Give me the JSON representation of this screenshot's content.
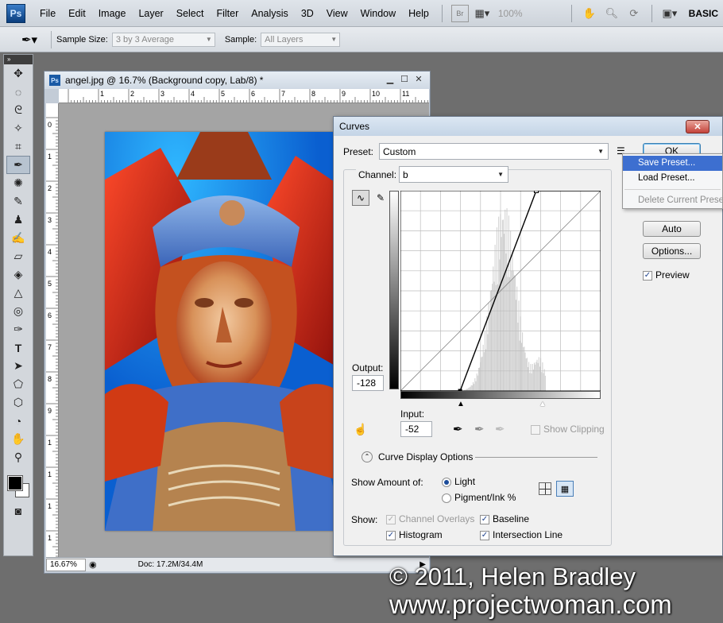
{
  "menubar": {
    "logo": "Ps",
    "items": [
      "File",
      "Edit",
      "Image",
      "Layer",
      "Select",
      "Filter",
      "Analysis",
      "3D",
      "View",
      "Window",
      "Help"
    ],
    "zoom": "100%",
    "br_label": "Br",
    "workspace": "BASIC"
  },
  "options": {
    "sample_size_label": "Sample Size:",
    "sample_size_value": "3 by 3 Average",
    "sample_label": "Sample:",
    "sample_value": "All Layers"
  },
  "document": {
    "title": "angel.jpg @ 16.7% (Background copy, Lab/8) *",
    "zoom": "16.67%",
    "doc_info": "Doc: 17.2M/34.4M",
    "ruler_top": [
      "1",
      "2",
      "3",
      "4",
      "5",
      "6",
      "7",
      "8",
      "9",
      "10",
      "11",
      "1"
    ],
    "ruler_left": [
      "0",
      "1",
      "2",
      "3",
      "4",
      "5",
      "6",
      "7",
      "8",
      "9",
      "1",
      "1",
      "1",
      "1"
    ]
  },
  "curves": {
    "title": "Curves",
    "close": "✕",
    "preset_label": "Preset:",
    "preset_value": "Custom",
    "channel_label": "Channel:",
    "channel_value": "b",
    "output_label": "Output:",
    "output_value": "-128",
    "input_label": "Input:",
    "input_value": "-52",
    "show_clipping": "Show Clipping",
    "display_options": "Curve Display Options",
    "show_amount_label": "Show Amount of:",
    "light": "Light",
    "pigment": "Pigment/Ink %",
    "show_label": "Show:",
    "channel_overlays": "Channel Overlays",
    "baseline": "Baseline",
    "histogram": "Histogram",
    "intersection": "Intersection Line",
    "ok": "OK",
    "auto": "Auto",
    "options": "Options...",
    "preview": "Preview",
    "curve_points": [
      {
        "input": -52,
        "output": -128
      },
      {
        "input": 45,
        "output": 127
      }
    ]
  },
  "context_menu": {
    "items": [
      "Save Preset...",
      "Load Preset...",
      "Delete Current Preset"
    ]
  },
  "watermark": {
    "line1": "© 2011, Helen Bradley",
    "line2": "www.projectwoman.com"
  }
}
